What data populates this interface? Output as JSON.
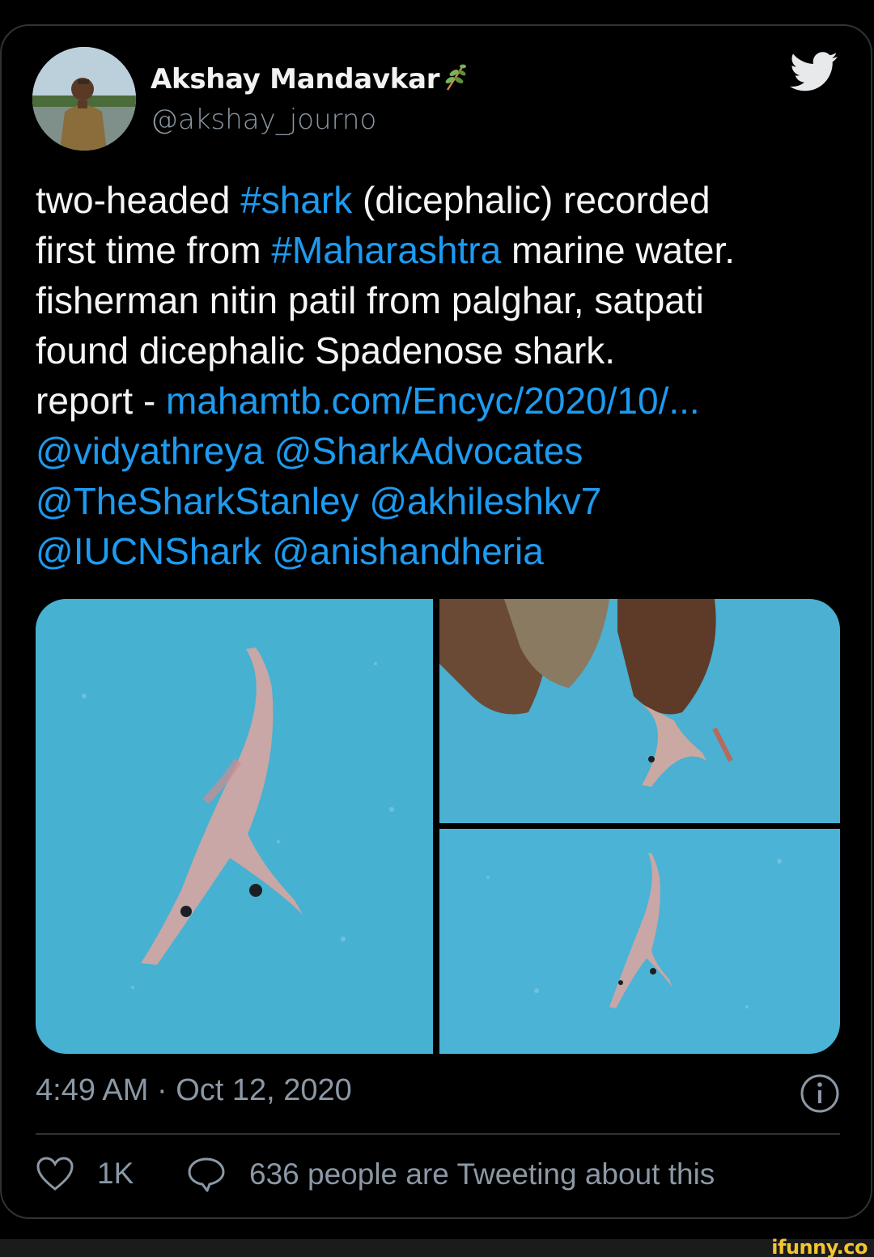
{
  "author": {
    "name": "Akshay Mandavkar",
    "handle": "@akshay_journo",
    "avatar_icon": "profile-photo",
    "verified_emoji_icon": "herb-icon"
  },
  "platform_icon": "twitter-bird-icon",
  "tweet": {
    "lines": [
      [
        {
          "t": "two-headed ",
          "link": false
        },
        {
          "t": "#shark",
          "link": true
        },
        {
          "t": " (dicephalic) recorded",
          "link": false
        }
      ],
      [
        {
          "t": "first time from ",
          "link": false
        },
        {
          "t": "#Maharashtra",
          "link": true
        },
        {
          "t": " marine water.",
          "link": false
        }
      ],
      [
        {
          "t": "fisherman nitin patil from palghar, satpati",
          "link": false
        }
      ],
      [
        {
          "t": "found dicephalic Spadenose shark.",
          "link": false
        }
      ],
      [
        {
          "t": "report - ",
          "link": false
        },
        {
          "t": "mahamtb.com/Encyc/2020/10/...",
          "link": true
        }
      ],
      [
        {
          "t": "@vidyathreya",
          "link": true
        },
        {
          "t": " ",
          "link": false
        },
        {
          "t": "@SharkAdvocates",
          "link": true
        }
      ],
      [
        {
          "t": "@TheSharkStanley",
          "link": true
        },
        {
          "t": " ",
          "link": false
        },
        {
          "t": "@akhileshkv7",
          "link": true
        }
      ],
      [
        {
          "t": "@IUCNShark",
          "link": true
        },
        {
          "t": " ",
          "link": false
        },
        {
          "t": "@anishandheria",
          "link": true
        }
      ]
    ]
  },
  "media": {
    "photos": [
      "shark-photo-full",
      "shark-photo-hands",
      "shark-photo-small"
    ]
  },
  "timestamp": "4:49 AM · Oct 12, 2020",
  "actions": {
    "like_count": "1K",
    "tweeting_text": "636 people are Tweeting about this"
  },
  "watermark": "ifunny.co",
  "colors": {
    "link": "#1d9bf0",
    "muted": "#8b98a5",
    "background": "#000000",
    "border": "#2f3336",
    "watermark": "#f4c531"
  }
}
